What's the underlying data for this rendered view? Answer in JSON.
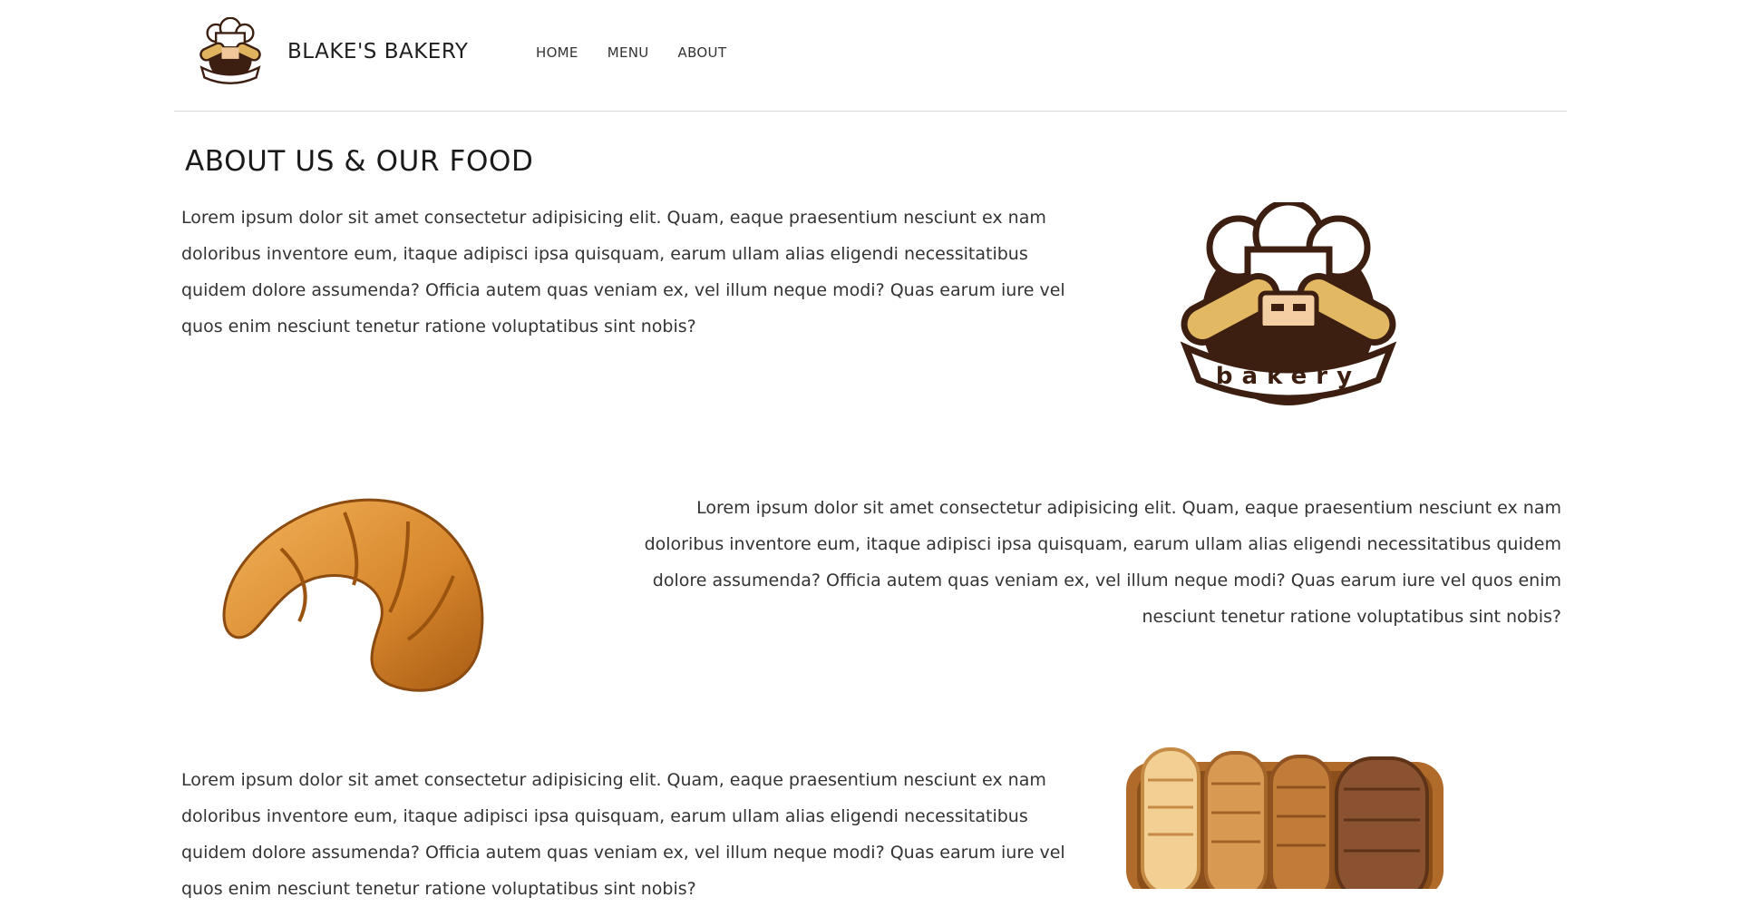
{
  "header": {
    "brand_name": "BLAKE'S BAKERY",
    "logo_icon": "chef-bakery-logo",
    "nav": [
      {
        "label": "HOME"
      },
      {
        "label": "MENU"
      },
      {
        "label": "ABOUT"
      }
    ]
  },
  "main": {
    "title": "ABOUT US & OUR FOOD",
    "sections": [
      {
        "text": "Lorem ipsum dolor sit amet consectetur adipisicing elit. Quam, eaque praesentium nesciunt ex nam doloribus inventore eum, itaque adipisci ipsa quisquam, earum ullam alias eligendi necessitatibus quidem dolore assumenda? Officia autem quas veniam ex, vel illum neque modi? Quas earum iure vel quos enim nesciunt tenetur ratione voluptatibus sint nobis?",
        "image": "chef-bakery-logo",
        "logo_text": "bakery"
      },
      {
        "text": "Lorem ipsum dolor sit amet consectetur adipisicing elit. Quam, eaque praesentium nesciunt ex nam doloribus inventore eum, itaque adipisci ipsa quisquam, earum ullam alias eligendi necessitatibus quidem dolore assumenda? Officia autem quas veniam ex, vel illum neque modi? Quas earum iure vel quos enim nesciunt tenetur ratione voluptatibus sint nobis?",
        "image": "croissant"
      },
      {
        "text": "Lorem ipsum dolor sit amet consectetur adipisicing elit. Quam, eaque praesentium nesciunt ex nam doloribus inventore eum, itaque adipisci ipsa quisquam, earum ullam alias eligendi necessitatibus quidem dolore assumenda? Officia autem quas veniam ex, vel illum neque modi? Quas earum iure vel quos enim nesciunt tenetur ratione voluptatibus sint nobis?",
        "image": "bread-basket"
      }
    ]
  },
  "colors": {
    "text": "#333333",
    "heading": "#1a1a1a",
    "divider": "#d8d8d8",
    "logo_brown": "#3d1f12",
    "bread": "#d9a45a"
  }
}
